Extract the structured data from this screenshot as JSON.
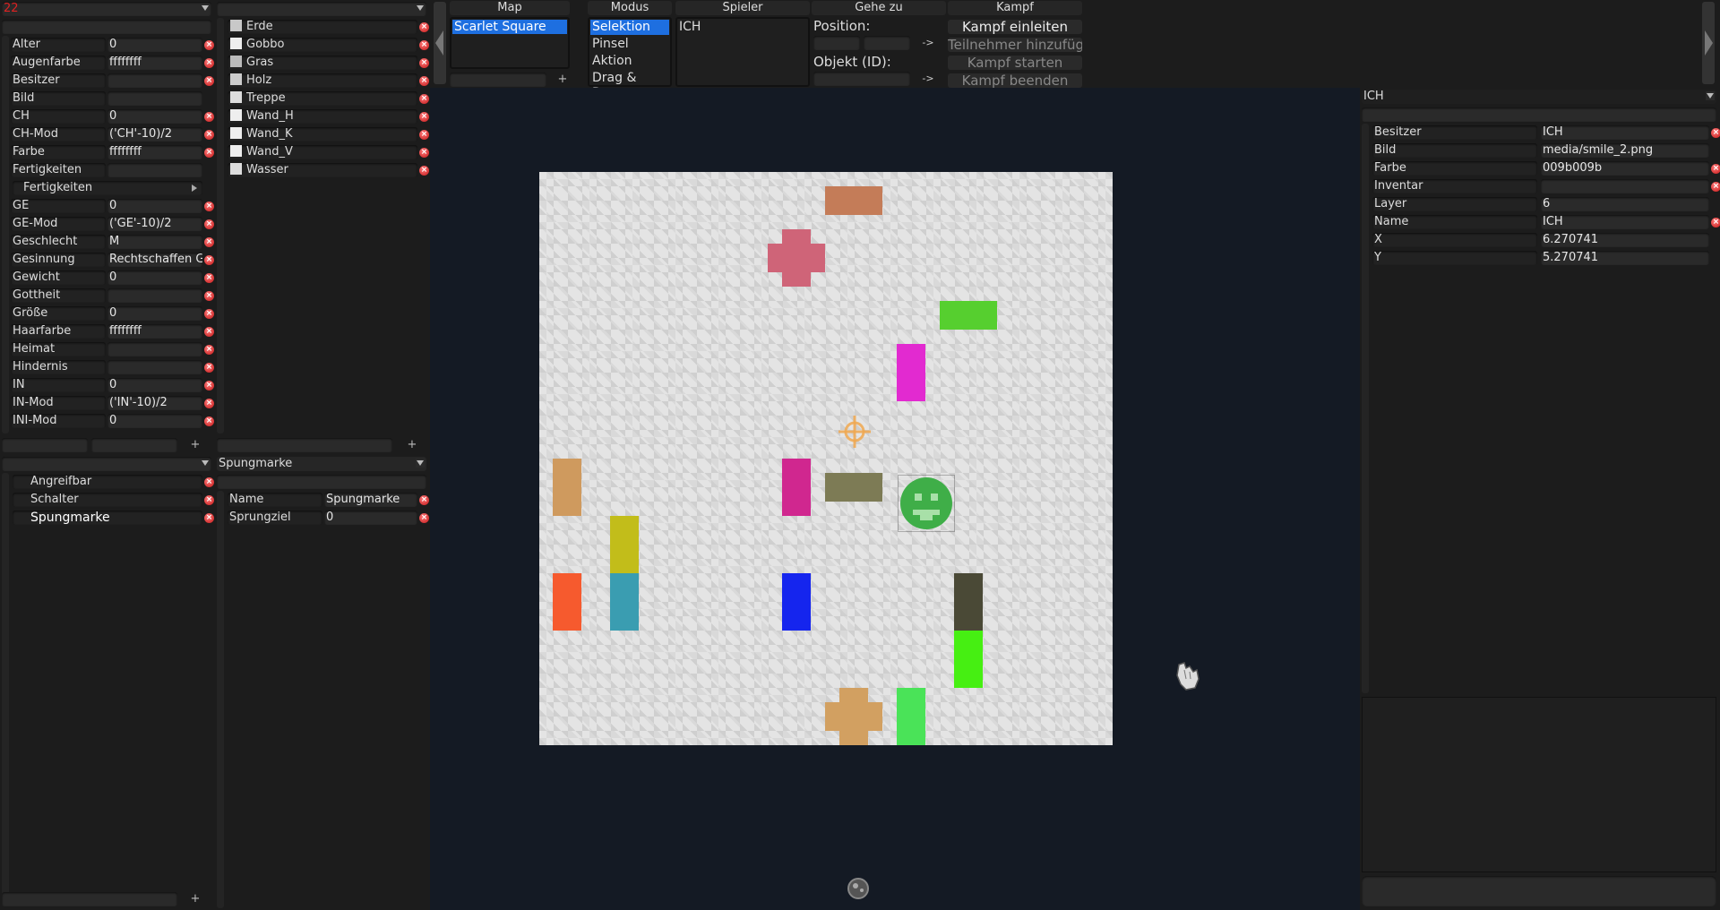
{
  "left_panel": {
    "top_field": "22",
    "props": [
      {
        "label": "Alter",
        "value": "0"
      },
      {
        "label": "Augenfarbe",
        "value": "ffffffff"
      },
      {
        "label": "Besitzer",
        "value": ""
      },
      {
        "label": "Bild",
        "value": ""
      },
      {
        "label": "CH",
        "value": "0"
      },
      {
        "label": "CH-Mod",
        "value": "('CH'-10)/2"
      },
      {
        "label": "Farbe",
        "value": "ffffffff"
      },
      {
        "label": "Fertigkeiten",
        "value": ""
      },
      {
        "label": "Fertigkeiten",
        "value": ""
      },
      {
        "label": "GE",
        "value": "0"
      },
      {
        "label": "GE-Mod",
        "value": "('GE'-10)/2"
      },
      {
        "label": "Geschlecht",
        "value": "M"
      },
      {
        "label": "Gesinnung",
        "value": "Rechtschaffen Gut"
      },
      {
        "label": "Gewicht",
        "value": "0"
      },
      {
        "label": "Gottheit",
        "value": ""
      },
      {
        "label": "Größe",
        "value": "0"
      },
      {
        "label": "Haarfarbe",
        "value": "ffffffff"
      },
      {
        "label": "Heimat",
        "value": ""
      },
      {
        "label": "Hindernis",
        "value": ""
      },
      {
        "label": "IN",
        "value": "0"
      },
      {
        "label": "IN-Mod",
        "value": "('IN'-10)/2"
      },
      {
        "label": "INI-Mod",
        "value": "0"
      }
    ],
    "plus": "+"
  },
  "tiles": {
    "items": [
      "Erde",
      "Gobbo",
      "Gras",
      "Holz",
      "Treppe",
      "Wand_H",
      "Wand_K",
      "Wand_V",
      "Wasser"
    ],
    "plus": "+"
  },
  "behaviors": {
    "items": [
      "Angreifbar",
      "Schalter",
      "Spungmarke"
    ],
    "plus": "+"
  },
  "spungmarke": {
    "dropdown": "Spungmarke",
    "rows": [
      {
        "label": "Name",
        "value": "Spungmarke"
      },
      {
        "label": "Sprungziel",
        "value": "0"
      }
    ]
  },
  "top_bar": {
    "map_header": "Map",
    "map_items": [
      "Scarlet Square"
    ],
    "modus_header": "Modus",
    "modus_items": [
      "Selektion",
      "Pinsel",
      "Aktion",
      "Drag & Drop"
    ],
    "spieler_header": "Spieler",
    "spieler_items": [
      "ICH"
    ],
    "gehe_header": "Gehe zu",
    "position_label": "Position:",
    "objekt_label": "Objekt (ID):",
    "go_arrow": "->",
    "kampf_header": "Kampf",
    "kampf_buttons": [
      "Kampf einleiten",
      "Teilnehmer hinzufügen",
      "Kampf starten",
      "Kampf beenden"
    ],
    "plus": "+"
  },
  "right_panel": {
    "dropdown": "ICH",
    "props": [
      {
        "label": "Besitzer",
        "value": "ICH"
      },
      {
        "label": "Bild",
        "value": "media/smile_2.png"
      },
      {
        "label": "Farbe",
        "value": "009b009b"
      },
      {
        "label": "Inventar",
        "value": ""
      },
      {
        "label": "Layer",
        "value": "6"
      },
      {
        "label": "Name",
        "value": "ICH"
      },
      {
        "label": "X",
        "value": "6.270741"
      },
      {
        "label": "Y",
        "value": "5.270741"
      }
    ]
  },
  "colors": {
    "selected": "#1e6fe0",
    "background": "#141a24"
  }
}
